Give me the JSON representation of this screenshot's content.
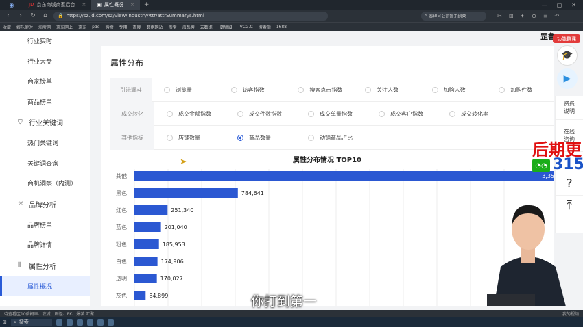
{
  "browser": {
    "tabs": [
      {
        "label": "京东商城商家后台"
      },
      {
        "label": "属性概况"
      }
    ],
    "url": "https://sz.jd.com/sz/view/industryAttr/attrSummarys.html",
    "search_placeholder": "泰坦号公司暂无组营",
    "bookmarks": [
      "收藏",
      "娱乐便时",
      "淘宝网",
      "京东网上",
      "京东",
      "pdd",
      "购物",
      "专用",
      "百度",
      "数据网站",
      "淘宝",
      "海品牌",
      "去数据",
      "【新版】",
      "VCG.C",
      "搜索指",
      "1688"
    ],
    "status_text": "待查看区10倍概率、攻城、刷怪、PK、爆装 汇聚",
    "status_right": "我的视频",
    "taskbar_search": "搜索"
  },
  "sidebar": {
    "items": [
      {
        "label": "行业实时",
        "type": "item"
      },
      {
        "label": "行业大盘",
        "type": "item"
      },
      {
        "label": "商家榜单",
        "type": "item"
      },
      {
        "label": "商品榜单",
        "type": "item"
      },
      {
        "label": "行业关键词",
        "type": "group",
        "icon": "shield-icon"
      },
      {
        "label": "热门关键词",
        "type": "item"
      },
      {
        "label": "关键词查询",
        "type": "item"
      },
      {
        "label": "商机洞察（内测）",
        "type": "item"
      },
      {
        "label": "品牌分析",
        "type": "group",
        "icon": "lightbulb-icon"
      },
      {
        "label": "品牌榜单",
        "type": "item"
      },
      {
        "label": "品牌详情",
        "type": "item"
      },
      {
        "label": "属性分析",
        "type": "group",
        "icon": "bars-icon"
      },
      {
        "label": "属性概况",
        "type": "item",
        "active": true
      }
    ]
  },
  "panel": {
    "title": "属性分布",
    "filters": [
      {
        "label": "引流漏斗",
        "options": [
          "浏览量",
          "访客指数",
          "搜索点击指数",
          "关注人数",
          "加购人数",
          "加购件数"
        ],
        "selected": -1
      },
      {
        "label": "成交转化",
        "options": [
          "成交金额指数",
          "成交件数指数",
          "成交单量指数",
          "成交客户指数",
          "成交转化率"
        ],
        "selected": -1
      },
      {
        "label": "其他指标",
        "options": [
          "店铺数量",
          "商品数量",
          "动销商品占比"
        ],
        "selected": 1
      }
    ]
  },
  "chart_data": {
    "type": "bar",
    "orientation": "horizontal",
    "title": "属性分布情况 TOP10",
    "categories": [
      "其他",
      "黑色",
      "红色",
      "蓝色",
      "粉色",
      "白色",
      "透明",
      "灰色"
    ],
    "values": [
      3350000,
      784641,
      251340,
      201040,
      185953,
      174906,
      170027,
      84899
    ],
    "value_labels": [
      "3,35",
      "784,641",
      "251,340",
      "201,040",
      "185,953",
      "174,906",
      "170,027",
      "84,899"
    ],
    "bar_color": "#2b58d2",
    "grid": true
  },
  "right_panel": {
    "brand": "罡鲁",
    "promo": "功能群课",
    "items": [
      "资费\n说明",
      "在线\n咨询"
    ],
    "help_glyph": "?",
    "top_glyph": "⏫"
  },
  "overlay": {
    "headline": "后期更",
    "number": "315"
  },
  "subtitle": "你打到第一"
}
